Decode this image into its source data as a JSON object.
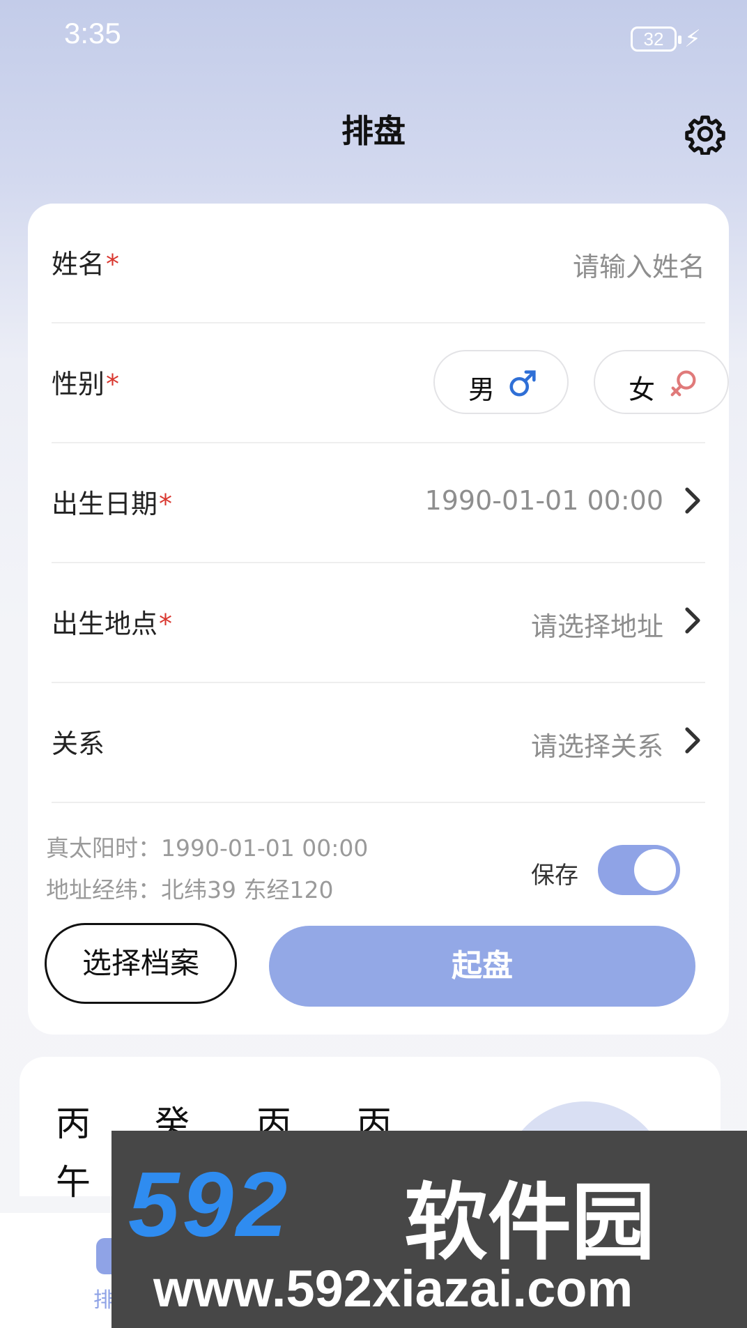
{
  "status_bar": {
    "time": "3:35",
    "battery": "32"
  },
  "header": {
    "title": "排盘"
  },
  "form": {
    "name": {
      "label": "姓名",
      "required": "*",
      "placeholder": "请输入姓名"
    },
    "gender": {
      "label": "性别",
      "required": "*",
      "male": "男",
      "female": "女"
    },
    "birth_date": {
      "label": "出生日期",
      "required": "*",
      "value": "1990-01-01 00:00"
    },
    "birth_place": {
      "label": "出生地点",
      "required": "*",
      "placeholder": "请选择地址"
    },
    "relation": {
      "label": "关系",
      "placeholder": "请选择关系"
    },
    "true_solar_time": "真太阳时：1990-01-01 00:00",
    "coordinates": "地址经纬：北纬39  东经120",
    "save_label": "保存",
    "save_enabled": true,
    "select_archive_button": "选择档案",
    "start_button": "起盘"
  },
  "chart_preview": {
    "row1": [
      "丙",
      "癸",
      "丙",
      "丙"
    ],
    "row2": [
      "午"
    ]
  },
  "tabbar": {
    "first_tab_label": "排"
  },
  "watermark": {
    "brand_number": "592",
    "brand_text": "软件园",
    "url": "www.592xiazai.com"
  },
  "colors": {
    "accent": "#93a8e6",
    "required": "#d9372f",
    "male": "#2f6fd6",
    "female": "#e07a7a"
  },
  "icons": [
    "gear-icon",
    "chevron-right-icon",
    "male-symbol-icon",
    "female-symbol-icon",
    "battery-icon",
    "charging-bolt-icon"
  ]
}
